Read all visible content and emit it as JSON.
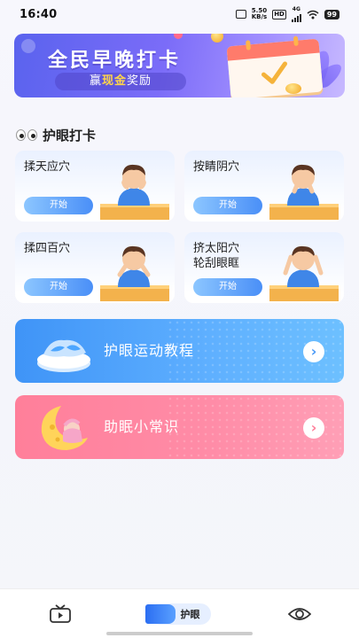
{
  "status_bar": {
    "time": "16:40",
    "speed_value": "5.50",
    "speed_unit": "KB/s",
    "hd": "HD",
    "network": "4G",
    "battery": "99"
  },
  "banner": {
    "title": "全民早晚打卡",
    "subtitle_pre": "赢",
    "subtitle_highlight": "现金",
    "subtitle_post": "奖励"
  },
  "section": {
    "title": "护眼打卡"
  },
  "cards": [
    {
      "name": "揉天应穴",
      "start": "开始"
    },
    {
      "name": "按睛阴穴",
      "start": "开始"
    },
    {
      "name": "揉四百穴",
      "start": "开始"
    },
    {
      "name": "挤太阳穴\n轮刮眼眶",
      "start": "开始"
    }
  ],
  "wide_banners": {
    "tutorial": {
      "label": "护眼运动教程",
      "arrow": "›"
    },
    "tips": {
      "label": "助眠小常识",
      "arrow": "›"
    }
  },
  "tabbar": {
    "active_label": "护眼"
  },
  "colors": {
    "primary_blue": "#4a8ff7",
    "pink": "#ff7f9a",
    "banner_purple": "#6c5cf0",
    "gold": "#ffd54a"
  }
}
